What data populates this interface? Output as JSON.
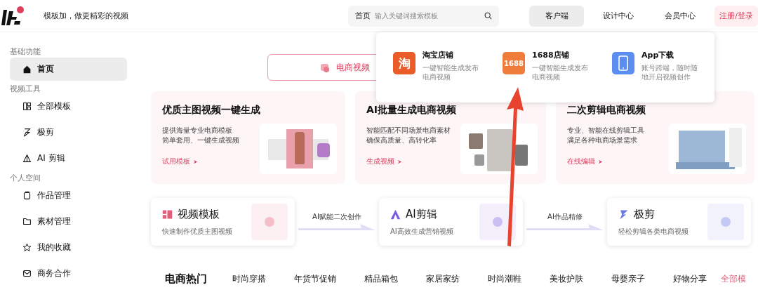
{
  "header": {
    "tagline": "模板加，做更精彩的视频",
    "search": {
      "scope": "首页",
      "placeholder": "输入关键词搜索模板"
    },
    "nav": [
      {
        "label": "客户端",
        "selected": true,
        "kind": "plain"
      },
      {
        "label": "设计中心",
        "selected": false,
        "kind": "plain"
      },
      {
        "label": "会员中心",
        "selected": false,
        "kind": "plain"
      },
      {
        "label": "注册/登录",
        "selected": false,
        "kind": "accent"
      }
    ]
  },
  "sidebar": {
    "sections": [
      {
        "title": "基础功能",
        "items": [
          {
            "label": "首页",
            "selected": true
          }
        ]
      },
      {
        "title": "视频工具",
        "items": [
          {
            "label": "全部模板",
            "selected": false
          },
          {
            "label": "极剪",
            "selected": false
          },
          {
            "label": "AI 剪辑",
            "selected": false
          }
        ]
      },
      {
        "title": "个人空间",
        "items": [
          {
            "label": "作品管理",
            "selected": false
          },
          {
            "label": "素材管理",
            "selected": false
          },
          {
            "label": "我的收藏",
            "selected": false
          },
          {
            "label": "商务合作",
            "selected": false
          }
        ]
      }
    ]
  },
  "category_tab": {
    "label": "电商视频",
    "selected": true
  },
  "feature_cards": [
    {
      "title": "优质主图视频一键生成",
      "lines": [
        "提供海量专业电商模板",
        "简单套用、一键生成视频"
      ],
      "link": "试用模板"
    },
    {
      "title": "AI批量生成电商视频",
      "lines": [
        "智能匹配不同场景电商素材",
        "确保高质量、高转化率"
      ],
      "link": "生成视频"
    },
    {
      "title": "二次剪辑电商视频",
      "lines": [
        "专业、智能在线剪辑工具",
        "满足各种电商场景需求"
      ],
      "link": "在线编辑"
    }
  ],
  "flow": [
    {
      "title": "视频模板",
      "subtitle": "快速制作优质主图视频",
      "color": "#e0607a"
    },
    {
      "connector": "AI赋能二次创作"
    },
    {
      "title": "AI剪辑",
      "subtitle": "AI高效生成营销视频",
      "color": "#7b5be0"
    },
    {
      "connector": "AI作品精修"
    },
    {
      "title": "极剪",
      "subtitle": "轻松剪辑各类电商视频",
      "color": "#6a78e0"
    }
  ],
  "hot": {
    "title": "电商热门",
    "items": [
      "时尚穿搭",
      "年货节促销",
      "精品箱包",
      "家居家纺",
      "时尚潮鞋",
      "美妆护肤",
      "母婴亲子",
      "好物分享"
    ],
    "more": "全部模"
  },
  "dropdown": [
    {
      "title": "淘宝店铺",
      "desc": [
        "一键智能生成发布",
        "电商视频"
      ],
      "glyph": "淘"
    },
    {
      "title": "1688店铺",
      "desc": [
        "一键智能生成发布",
        "电商视频"
      ],
      "glyph": "1688"
    },
    {
      "title": "App下载",
      "desc": [
        "账号跨端，随时随",
        "地开启视频创作"
      ]
    }
  ]
}
